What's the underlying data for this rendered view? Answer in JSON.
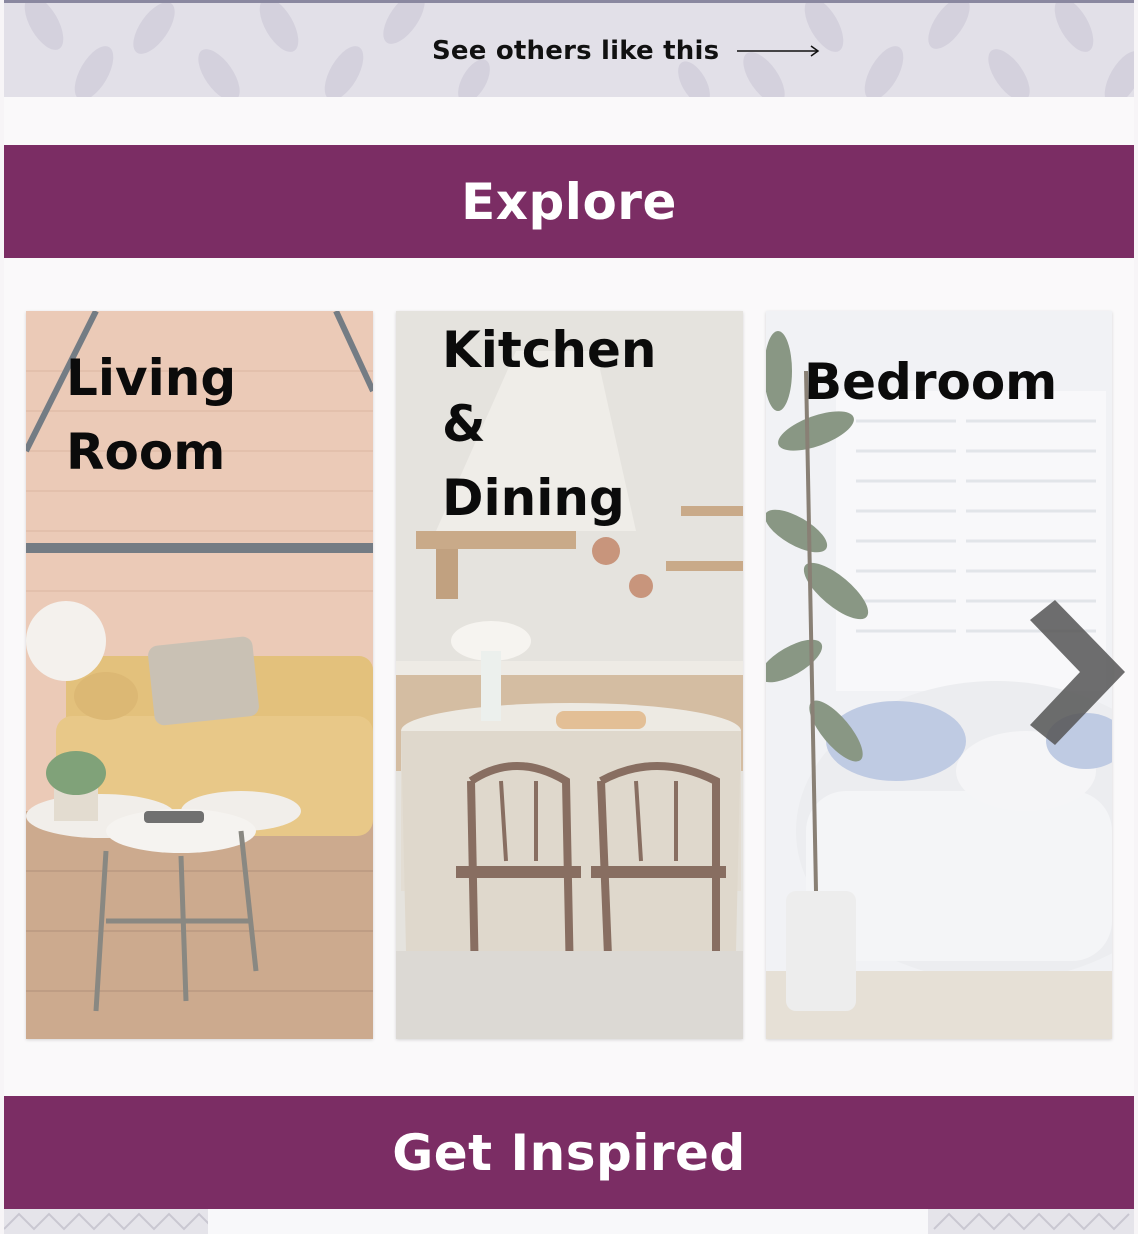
{
  "see_others": {
    "label": "See others like this"
  },
  "explore": {
    "heading": "Explore"
  },
  "rooms": [
    {
      "title": "Living\nRoom"
    },
    {
      "title": "Kitchen\n&\nDining"
    },
    {
      "title": "Bedroom"
    }
  ],
  "inspired": {
    "heading": "Get Inspired"
  },
  "colors": {
    "band": "#7b2d64",
    "top_strip": "#e2e0e8",
    "arrow": "#5a5a5a"
  },
  "icons": {
    "arrow": "long-right-arrow-icon",
    "next": "chevron-right-icon"
  }
}
